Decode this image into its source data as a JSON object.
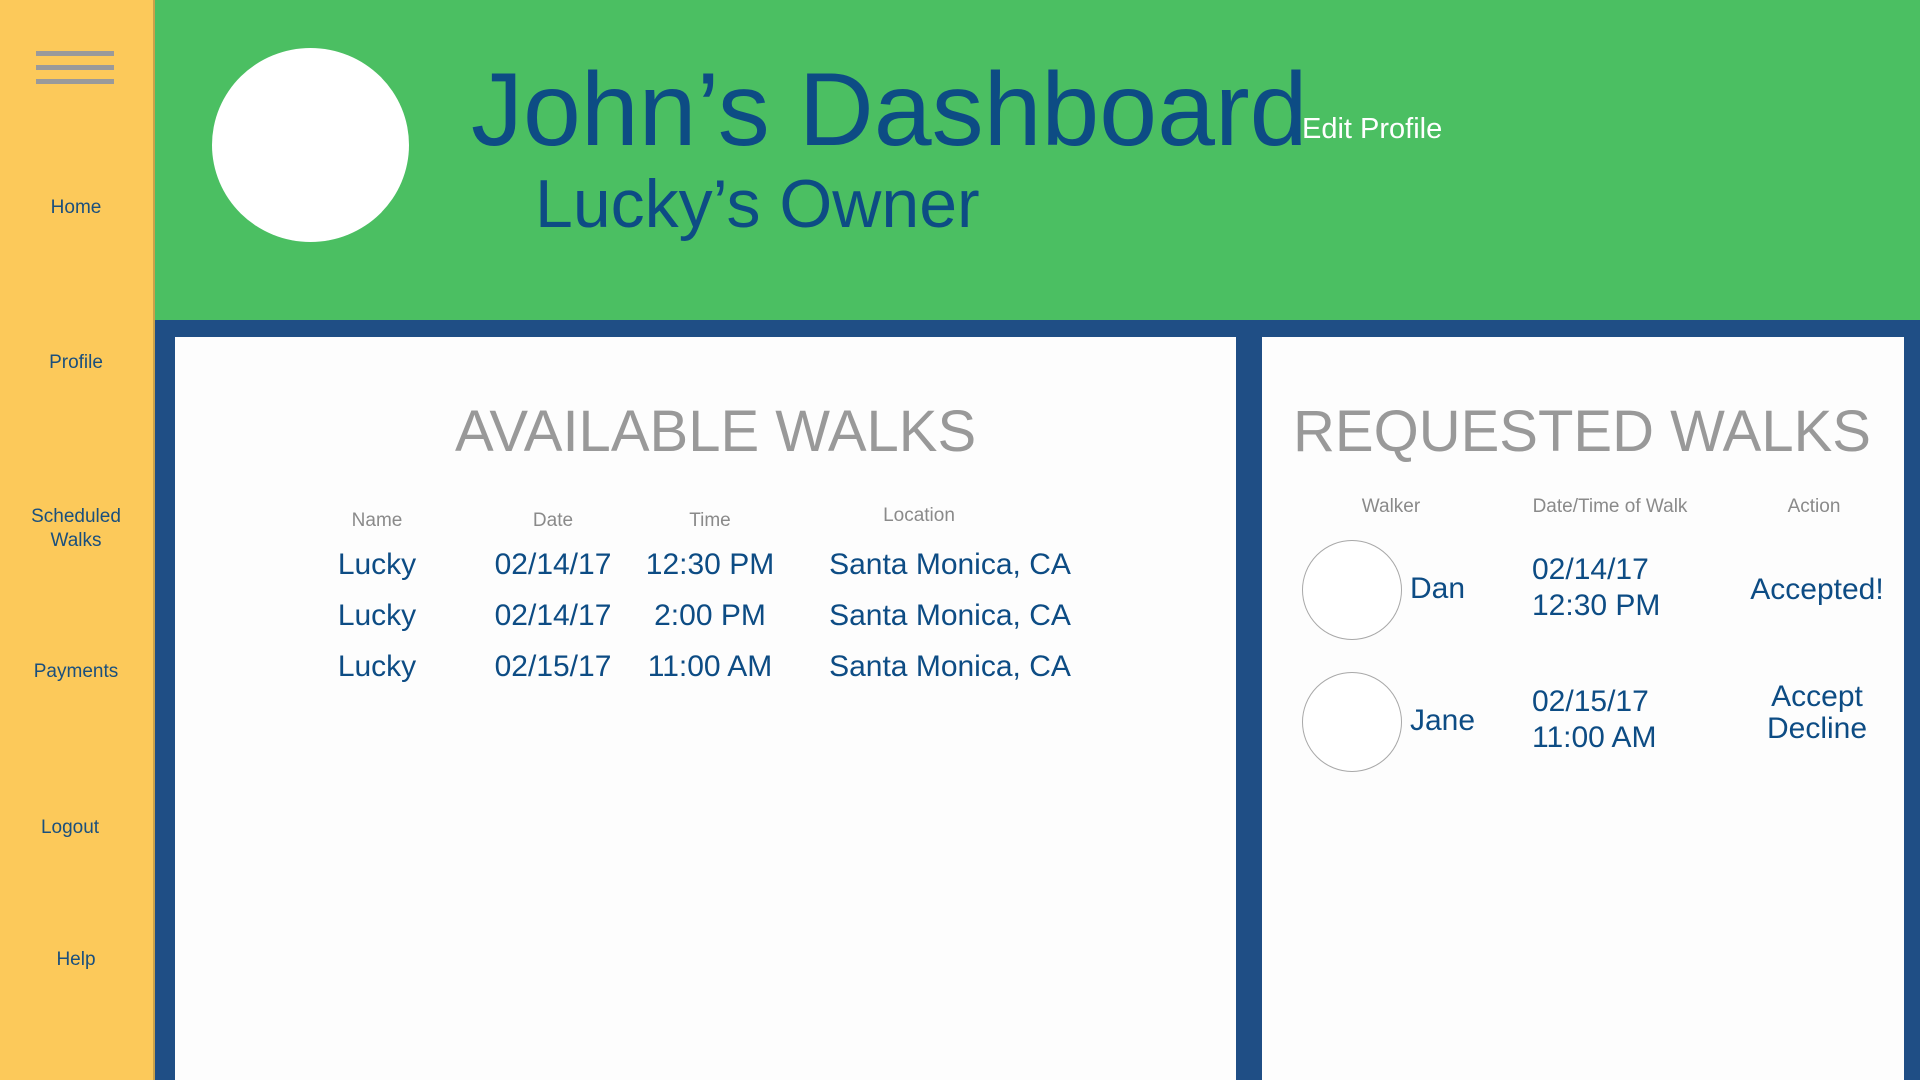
{
  "sidebar": {
    "menu_icon": "hamburger-menu-icon",
    "items": [
      {
        "label": "Home"
      },
      {
        "label": "Profile"
      },
      {
        "label": "Scheduled\nWalks"
      },
      {
        "label": "Payments"
      },
      {
        "label": "Logout"
      },
      {
        "label": "Help"
      }
    ]
  },
  "header": {
    "title": "John’s Dashboard",
    "subtitle": "Lucky’s Owner",
    "edit_profile_label": "Edit Profile"
  },
  "available_walks": {
    "title": "AVAILABLE WALKS",
    "columns": {
      "name": "Name",
      "date": "Date",
      "time": "Time",
      "location": "Location"
    },
    "rows": [
      {
        "name": "Lucky",
        "date": "02/14/17",
        "time": "12:30 PM",
        "location": "Santa Monica, CA"
      },
      {
        "name": "Lucky",
        "date": "02/14/17",
        "time": "2:00 PM",
        "location": "Santa Monica, CA"
      },
      {
        "name": "Lucky",
        "date": "02/15/17",
        "time": "11:00 AM",
        "location": "Santa Monica, CA"
      }
    ]
  },
  "requested_walks": {
    "title": "REQUESTED WALKS",
    "columns": {
      "walker": "Walker",
      "datetime": "Date/Time of Walk",
      "action": "Action"
    },
    "rows": [
      {
        "walker": "Dan",
        "date": "02/14/17",
        "time": "12:30 PM",
        "status": "Accepted!"
      },
      {
        "walker": "Jane",
        "date": "02/15/17",
        "time": "11:00 AM",
        "accept_label": "Accept",
        "decline_label": "Decline"
      }
    ]
  },
  "colors": {
    "sidebar": "#fcc95a",
    "header": "#4bbf62",
    "frame": "#1f4e85",
    "primary_text": "#0d4c84",
    "muted_text": "#999999"
  }
}
